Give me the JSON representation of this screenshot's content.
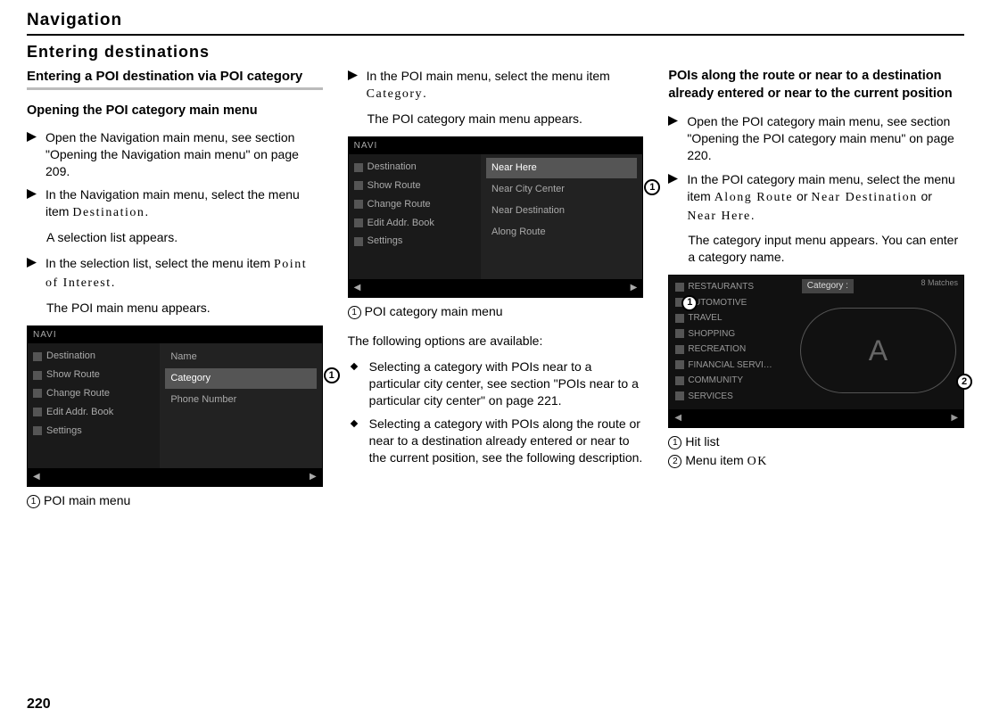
{
  "chapter": "Navigation",
  "section": "Entering destinations",
  "page_number": "220",
  "col1": {
    "title": "Entering a POI destination via POI category",
    "subheading": "Opening the POI category main menu",
    "step1": "Open the Navigation main menu, see section \"Opening the Navigation main menu\" on page 209.",
    "step2a": "In the Navigation main menu, select the menu item ",
    "step2_term": "Destination",
    "step2b": ".",
    "result2": "A selection list appears.",
    "step3a": "In the selection list, select the menu item ",
    "step3_term": "Point of Interest",
    "step3b": ".",
    "result3": "The POI main menu appears.",
    "caption": "POI main menu",
    "ss": {
      "top": "NAVI",
      "left": [
        "Destination",
        "Show Route",
        "Change Route",
        "Edit Addr. Book",
        "Settings"
      ],
      "right": [
        "Name",
        "Category",
        "Phone Number"
      ],
      "callout": "1"
    }
  },
  "col2": {
    "step1a": "In the POI main menu, select the menu item ",
    "step1_term": "Category",
    "step1b": ".",
    "result1": "The POI category main menu appears.",
    "caption": "POI category main menu",
    "following": "The following options are available:",
    "bullet1": "Selecting a category with POIs near to a particular city center, see section \"POIs near to a particular city center\" on page 221.",
    "bullet2": "Selecting a category with POIs along the route or near to a destination already entered or near to the current position, see the following description.",
    "ss": {
      "top": "NAVI",
      "left": [
        "Destination",
        "Show Route",
        "Change Route",
        "Edit Addr. Book",
        "Settings"
      ],
      "right": [
        "Near Here",
        "Near City Center",
        "Near Destination",
        "Along Route"
      ],
      "callout": "1"
    }
  },
  "col3": {
    "title": "POIs along the route or near to a destination already entered or near to the current position",
    "step1": "Open the POI category main menu, see section \"Opening the POI category main menu\" on page 220.",
    "step2a": "In the POI category main menu, select the menu item ",
    "step2_term1": "Along Route",
    "step2_or1": " or ",
    "step2_term2": "Near Destination",
    "step2_or2": " or ",
    "step2_term3": "Near Here",
    "step2b": ".",
    "result2": "The category input menu appears. You can enter a category name.",
    "caption1": "Hit list",
    "caption2a": "Menu item ",
    "caption2_term": "OK",
    "ss": {
      "left": [
        "RESTAURANTS",
        "AUTOMOTIVE",
        "TRAVEL",
        "SHOPPING",
        "RECREATION",
        "FINANCIAL SERVI…",
        "COMMUNITY",
        "SERVICES"
      ],
      "category_label": "Category :",
      "matches": "8 Matches",
      "callout1": "1",
      "callout2": "2"
    }
  }
}
